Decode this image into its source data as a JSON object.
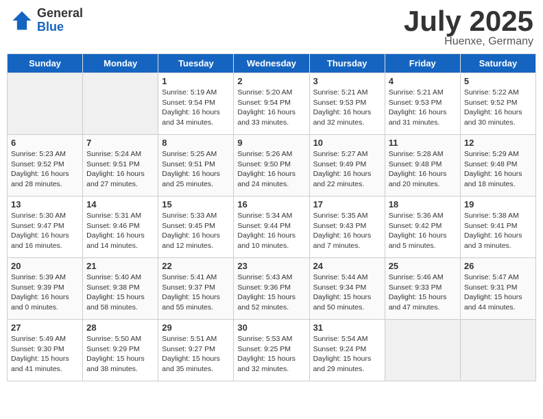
{
  "header": {
    "logo_general": "General",
    "logo_blue": "Blue",
    "month": "July 2025",
    "location": "Huenxe, Germany"
  },
  "days_of_week": [
    "Sunday",
    "Monday",
    "Tuesday",
    "Wednesday",
    "Thursday",
    "Friday",
    "Saturday"
  ],
  "weeks": [
    [
      {
        "day": "",
        "info": ""
      },
      {
        "day": "",
        "info": ""
      },
      {
        "day": "1",
        "info": "Sunrise: 5:19 AM\nSunset: 9:54 PM\nDaylight: 16 hours and 34 minutes."
      },
      {
        "day": "2",
        "info": "Sunrise: 5:20 AM\nSunset: 9:54 PM\nDaylight: 16 hours and 33 minutes."
      },
      {
        "day": "3",
        "info": "Sunrise: 5:21 AM\nSunset: 9:53 PM\nDaylight: 16 hours and 32 minutes."
      },
      {
        "day": "4",
        "info": "Sunrise: 5:21 AM\nSunset: 9:53 PM\nDaylight: 16 hours and 31 minutes."
      },
      {
        "day": "5",
        "info": "Sunrise: 5:22 AM\nSunset: 9:52 PM\nDaylight: 16 hours and 30 minutes."
      }
    ],
    [
      {
        "day": "6",
        "info": "Sunrise: 5:23 AM\nSunset: 9:52 PM\nDaylight: 16 hours and 28 minutes."
      },
      {
        "day": "7",
        "info": "Sunrise: 5:24 AM\nSunset: 9:51 PM\nDaylight: 16 hours and 27 minutes."
      },
      {
        "day": "8",
        "info": "Sunrise: 5:25 AM\nSunset: 9:51 PM\nDaylight: 16 hours and 25 minutes."
      },
      {
        "day": "9",
        "info": "Sunrise: 5:26 AM\nSunset: 9:50 PM\nDaylight: 16 hours and 24 minutes."
      },
      {
        "day": "10",
        "info": "Sunrise: 5:27 AM\nSunset: 9:49 PM\nDaylight: 16 hours and 22 minutes."
      },
      {
        "day": "11",
        "info": "Sunrise: 5:28 AM\nSunset: 9:48 PM\nDaylight: 16 hours and 20 minutes."
      },
      {
        "day": "12",
        "info": "Sunrise: 5:29 AM\nSunset: 9:48 PM\nDaylight: 16 hours and 18 minutes."
      }
    ],
    [
      {
        "day": "13",
        "info": "Sunrise: 5:30 AM\nSunset: 9:47 PM\nDaylight: 16 hours and 16 minutes."
      },
      {
        "day": "14",
        "info": "Sunrise: 5:31 AM\nSunset: 9:46 PM\nDaylight: 16 hours and 14 minutes."
      },
      {
        "day": "15",
        "info": "Sunrise: 5:33 AM\nSunset: 9:45 PM\nDaylight: 16 hours and 12 minutes."
      },
      {
        "day": "16",
        "info": "Sunrise: 5:34 AM\nSunset: 9:44 PM\nDaylight: 16 hours and 10 minutes."
      },
      {
        "day": "17",
        "info": "Sunrise: 5:35 AM\nSunset: 9:43 PM\nDaylight: 16 hours and 7 minutes."
      },
      {
        "day": "18",
        "info": "Sunrise: 5:36 AM\nSunset: 9:42 PM\nDaylight: 16 hours and 5 minutes."
      },
      {
        "day": "19",
        "info": "Sunrise: 5:38 AM\nSunset: 9:41 PM\nDaylight: 16 hours and 3 minutes."
      }
    ],
    [
      {
        "day": "20",
        "info": "Sunrise: 5:39 AM\nSunset: 9:39 PM\nDaylight: 16 hours and 0 minutes."
      },
      {
        "day": "21",
        "info": "Sunrise: 5:40 AM\nSunset: 9:38 PM\nDaylight: 15 hours and 58 minutes."
      },
      {
        "day": "22",
        "info": "Sunrise: 5:41 AM\nSunset: 9:37 PM\nDaylight: 15 hours and 55 minutes."
      },
      {
        "day": "23",
        "info": "Sunrise: 5:43 AM\nSunset: 9:36 PM\nDaylight: 15 hours and 52 minutes."
      },
      {
        "day": "24",
        "info": "Sunrise: 5:44 AM\nSunset: 9:34 PM\nDaylight: 15 hours and 50 minutes."
      },
      {
        "day": "25",
        "info": "Sunrise: 5:46 AM\nSunset: 9:33 PM\nDaylight: 15 hours and 47 minutes."
      },
      {
        "day": "26",
        "info": "Sunrise: 5:47 AM\nSunset: 9:31 PM\nDaylight: 15 hours and 44 minutes."
      }
    ],
    [
      {
        "day": "27",
        "info": "Sunrise: 5:49 AM\nSunset: 9:30 PM\nDaylight: 15 hours and 41 minutes."
      },
      {
        "day": "28",
        "info": "Sunrise: 5:50 AM\nSunset: 9:29 PM\nDaylight: 15 hours and 38 minutes."
      },
      {
        "day": "29",
        "info": "Sunrise: 5:51 AM\nSunset: 9:27 PM\nDaylight: 15 hours and 35 minutes."
      },
      {
        "day": "30",
        "info": "Sunrise: 5:53 AM\nSunset: 9:25 PM\nDaylight: 15 hours and 32 minutes."
      },
      {
        "day": "31",
        "info": "Sunrise: 5:54 AM\nSunset: 9:24 PM\nDaylight: 15 hours and 29 minutes."
      },
      {
        "day": "",
        "info": ""
      },
      {
        "day": "",
        "info": ""
      }
    ]
  ]
}
